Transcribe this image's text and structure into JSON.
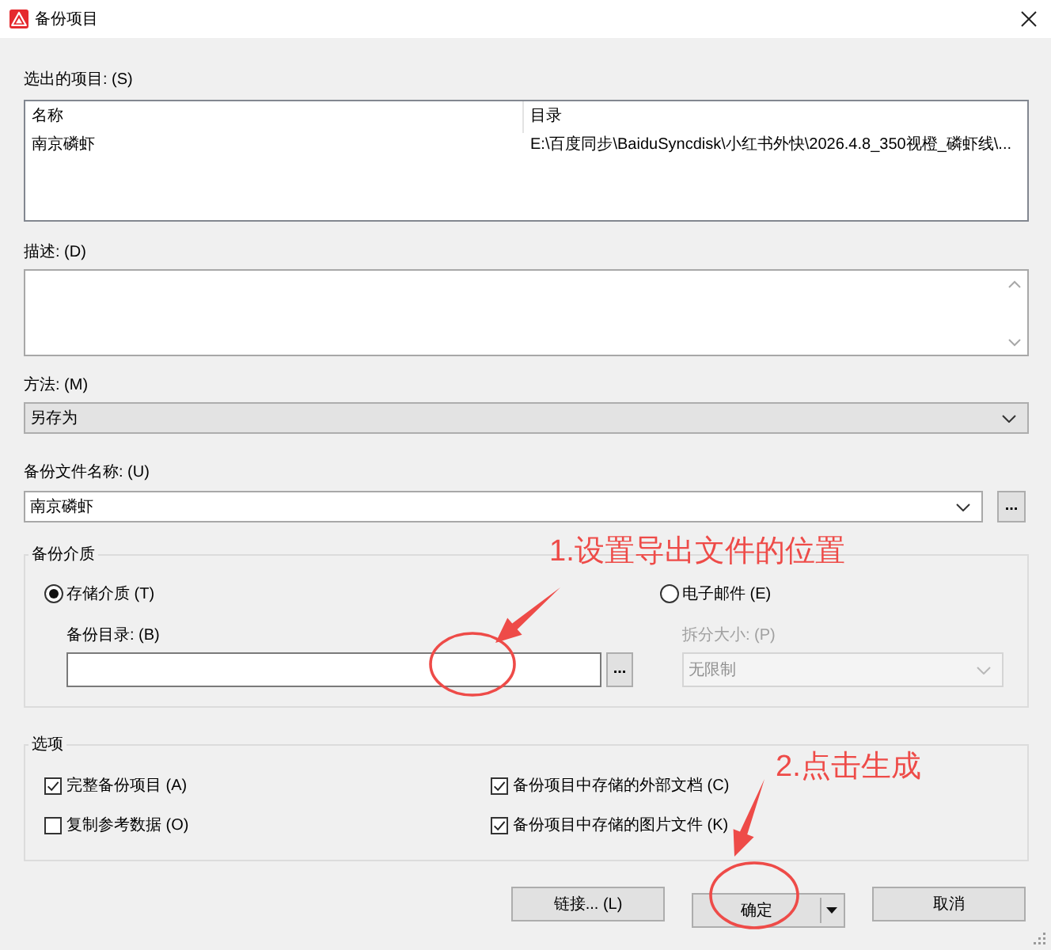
{
  "window": {
    "title": "备份项目"
  },
  "selected_items": {
    "label": "选出的项目: (S)",
    "columns": [
      "名称",
      "目录"
    ],
    "rows": [
      {
        "cells": [
          "南京磷虾",
          "E:\\百度同步\\BaiduSyncdisk\\小红书外快\\2026.4.8_350视橙_磷虾线\\..."
        ]
      }
    ]
  },
  "description": {
    "label": "描述: (D)"
  },
  "method": {
    "label": "方法: (M)",
    "value": "另存为"
  },
  "backup_file_name": {
    "label": "备份文件名称: (U)",
    "value": "南京磷虾",
    "browse_button": "..."
  },
  "backup_media": {
    "title": "备份介质",
    "options": [
      {
        "label": "存储介质 (T)",
        "selected": true
      },
      {
        "label": "电子邮件 (E)",
        "selected": false
      }
    ],
    "directory": {
      "label": "备份目录: (B)",
      "browse_button": "..."
    },
    "split_size": {
      "label": "拆分大小: (P)",
      "value": "无限制",
      "disabled": true
    }
  },
  "options": {
    "title": "选项",
    "items": [
      {
        "label": "完整备份项目 (A)",
        "checked": true
      },
      {
        "label": "备份项目中存储的外部文档 (C)",
        "checked": true
      },
      {
        "label": "复制参考数据 (O)",
        "checked": false
      },
      {
        "label": "备份项目中存储的图片文件 (K)",
        "checked": true
      }
    ]
  },
  "buttons": [
    {
      "label": "链接... (L)",
      "kind": "plain"
    },
    {
      "label": "确定",
      "kind": "split"
    },
    {
      "label": "取消",
      "kind": "plain"
    }
  ],
  "annotations": [
    {
      "text": "1.设置导出文件的位置"
    },
    {
      "text": "2.点击生成"
    }
  ]
}
